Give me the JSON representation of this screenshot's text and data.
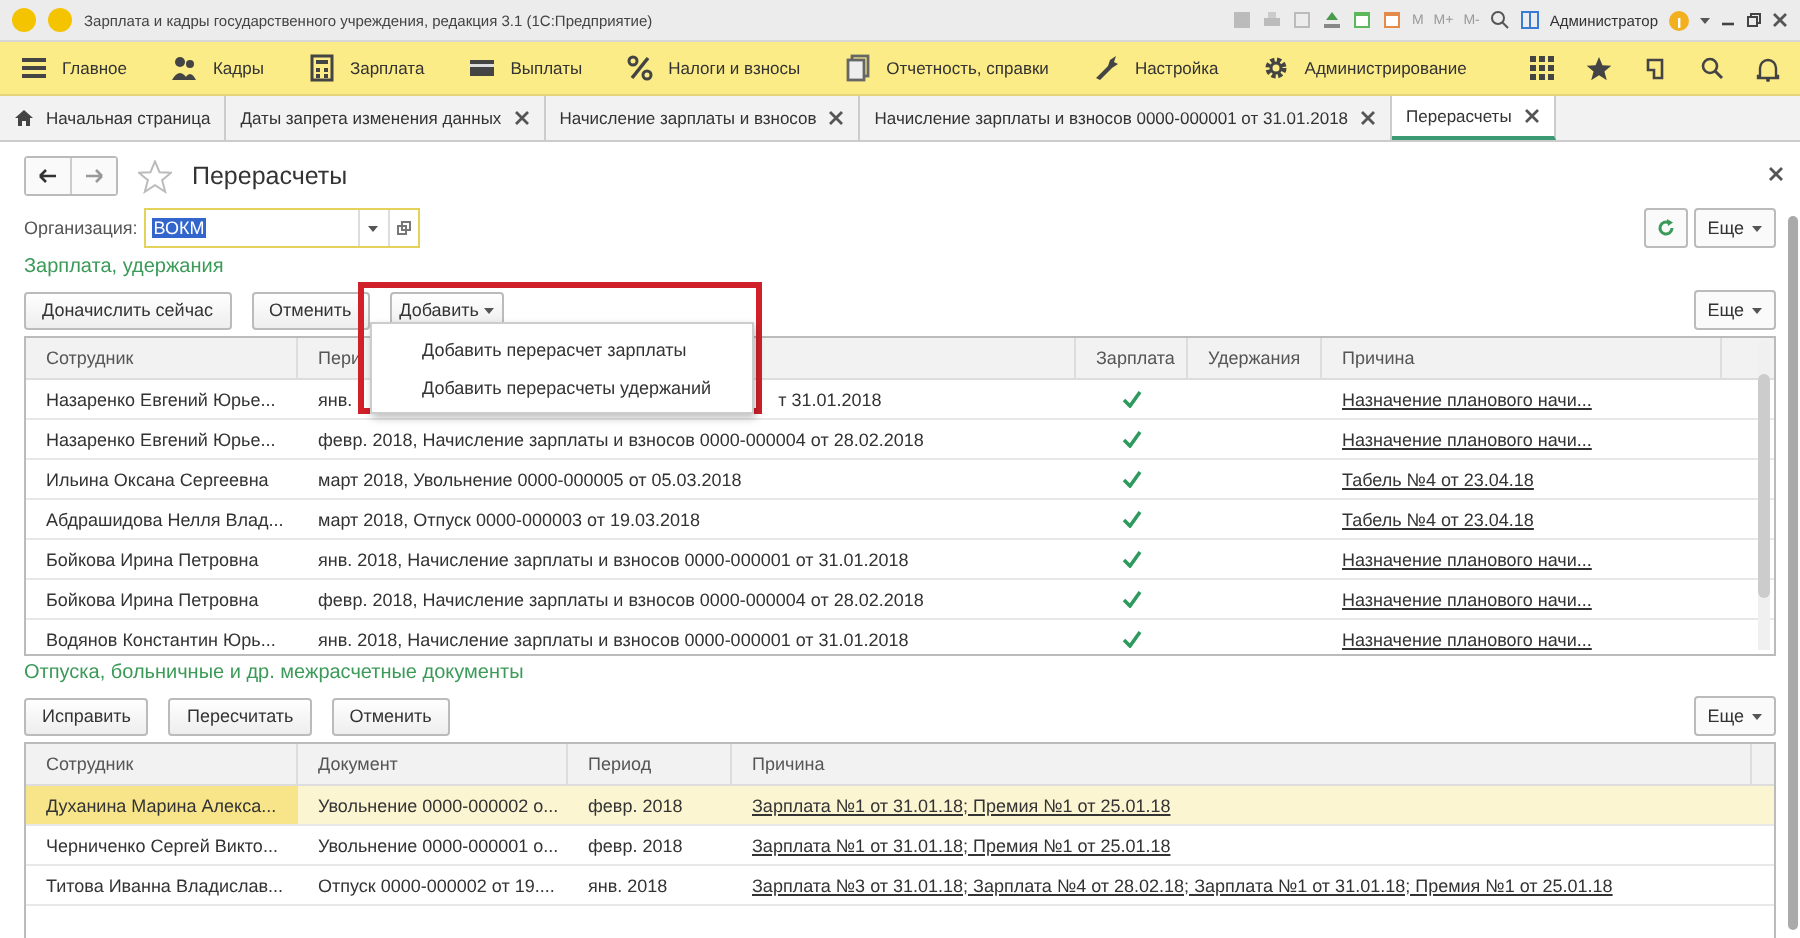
{
  "window": {
    "title": "Зарплата и кадры государственного учреждения, редакция 3.1  (1С:Предприятие)",
    "memory_keys": [
      "M",
      "M+",
      "M-"
    ],
    "user": "Администратор"
  },
  "sections": [
    {
      "label": "Главное"
    },
    {
      "label": "Кадры"
    },
    {
      "label": "Зарплата"
    },
    {
      "label": "Выплаты"
    },
    {
      "label": "Налоги и взносы"
    },
    {
      "label": "Отчетность, справки"
    },
    {
      "label": "Настройка"
    },
    {
      "label": "Администрирование"
    }
  ],
  "tabs": [
    {
      "label": "Начальная страница",
      "kind": "home",
      "selected": false
    },
    {
      "label": "Даты запрета изменения данных",
      "kind": "closable",
      "selected": false
    },
    {
      "label": "Начисление зарплаты и взносов",
      "kind": "closable",
      "selected": false
    },
    {
      "label": "Начисление зарплаты и взносов 0000-000001 от 31.01.2018",
      "kind": "closable",
      "selected": false
    },
    {
      "label": "Перерасчеты",
      "kind": "closable",
      "selected": true
    }
  ],
  "form": {
    "title": "Перерасчеты",
    "organization": {
      "label": "Организация:",
      "value": "ВОКМ"
    },
    "more": "Еще"
  },
  "payroll": {
    "title": "Зарплата, удержания",
    "buttons": [
      "Доначислить сейчас",
      "Отменить"
    ],
    "add_button": "Добавить",
    "more": "Еще",
    "add_menu": {
      "items": [
        "Добавить перерасчет зарплаты",
        "Добавить перерасчеты удержаний"
      ]
    },
    "columns": [
      "Сотрудник",
      "Пери",
      "Зарплата",
      "Удержания",
      "Причина"
    ],
    "rows": [
      {
        "employee": "Назаренко Евгений Юрье...",
        "period": "янв.",
        "period_tail": "т 31.01.2018",
        "salary": true,
        "deductions": false,
        "reason": "Назначение планового начи..."
      },
      {
        "employee": "Назаренко Евгений Юрье...",
        "period": "февр. 2018, Начисление зарплаты и взносов 0000-000004 от 28.02.2018",
        "salary": true,
        "deductions": false,
        "reason": "Назначение планового начи..."
      },
      {
        "employee": "Ильина Оксана Сергеевна",
        "period": "март 2018, Увольнение 0000-000005 от 05.03.2018",
        "salary": true,
        "deductions": false,
        "reason": "Табель №4 от 23.04.18"
      },
      {
        "employee": "Абдрашидова Нелля Влад...",
        "period": "март 2018, Отпуск 0000-000003 от 19.03.2018",
        "salary": true,
        "deductions": false,
        "reason": "Табель №4 от 23.04.18"
      },
      {
        "employee": "Бойкова Ирина Петровна",
        "period": "янв. 2018, Начисление зарплаты и взносов 0000-000001 от 31.01.2018",
        "salary": true,
        "deductions": false,
        "reason": "Назначение планового начи..."
      },
      {
        "employee": "Бойкова Ирина Петровна",
        "period": "февр. 2018, Начисление зарплаты и взносов 0000-000004 от 28.02.2018",
        "salary": true,
        "deductions": false,
        "reason": "Назначение планового начи..."
      },
      {
        "employee": "Водянов Константин Юрь...",
        "period": "янв. 2018, Начисление зарплаты и взносов 0000-000001 от 31.01.2018",
        "salary": true,
        "deductions": false,
        "reason": "Назначение планового начи..."
      }
    ]
  },
  "documents": {
    "title": "Отпуска, больничные и др. межрасчетные документы",
    "buttons": [
      "Исправить",
      "Пересчитать",
      "Отменить"
    ],
    "more": "Еще",
    "columns": [
      "Сотрудник",
      "Документ",
      "Период",
      "Причина"
    ],
    "rows": [
      {
        "employee": "Духанина Марина Алекса...",
        "document": "Увольнение 0000-000002 о...",
        "period": "февр. 2018",
        "reason": "Зарплата №1 от 31.01.18; Премия №1 от 25.01.18",
        "selected": true
      },
      {
        "employee": "Черниченко Сергей Викто...",
        "document": "Увольнение 0000-000001 о...",
        "period": "февр. 2018",
        "reason": "Зарплата №1 от 31.01.18; Премия №1 от 25.01.18",
        "selected": false
      },
      {
        "employee": "Титова Иванна Владислав...",
        "document": "Отпуск 0000-000002 от 19....",
        "period": "янв. 2018",
        "reason": "Зарплата №3 от 31.01.18; Зарплата №4 от 28.02.18; Зарплата №1 от 31.01.18; Премия №1 от 25.01.18",
        "selected": false
      }
    ]
  }
}
